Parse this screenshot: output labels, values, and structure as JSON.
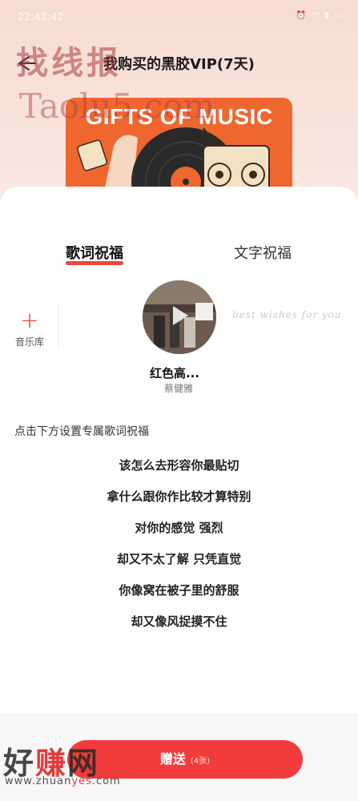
{
  "status": {
    "time": "22:42:42",
    "icons": [
      "alarm-icon",
      "data-speed-icon",
      "wifi-icon",
      "signal-icon",
      "battery-icon"
    ]
  },
  "header": {
    "title": "我购买的黑胶VIP(7天)"
  },
  "banner": {
    "title": "GIFTS OF MUSIC"
  },
  "tabs": [
    {
      "label": "歌词祝福",
      "active": true
    },
    {
      "label": "文字祝福",
      "active": false
    }
  ],
  "library": {
    "label": "音乐库"
  },
  "song": {
    "name": "红色高...",
    "artist": "蔡健雅",
    "wishes": "best wishes for you"
  },
  "hint": "点击下方设置专属歌词祝福",
  "lyrics": [
    "该怎么去形容你最贴切",
    "拿什么跟你作比较才算特别",
    "对你的感觉 强烈",
    "却又不太了解 只凭直觉",
    "你像窝在被子里的舒服",
    "却又像风捉摸不住"
  ],
  "send": {
    "label": "赠送",
    "count": "(4张)"
  },
  "watermarks": {
    "top": "找线报",
    "site": "Taolu5.com",
    "bottom_a": "好",
    "bottom_b": "赚",
    "bottom_c": "网",
    "url_a": "www.zhuan",
    "url_b": "yes",
    "url_c": ".com"
  },
  "colors": {
    "accent": "#f23c3c",
    "banner": "#f0662f"
  }
}
